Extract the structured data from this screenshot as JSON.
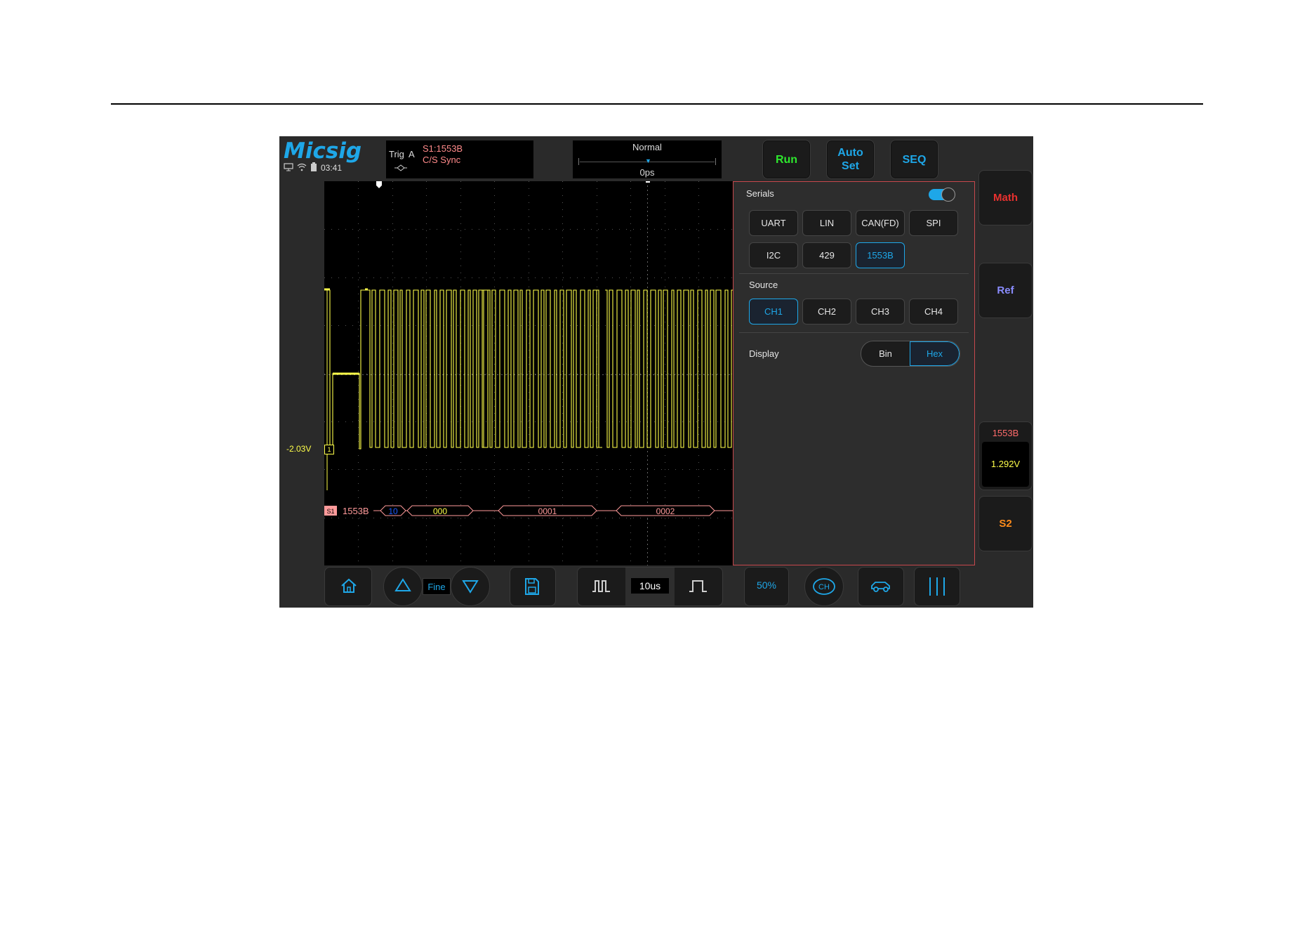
{
  "brand": {
    "logo": "Micsig"
  },
  "status": {
    "time": "03:41"
  },
  "trigger": {
    "label": "Trig",
    "channel": "A",
    "source": "S1:1553B",
    "mode": "C/S Sync"
  },
  "acquisition": {
    "mode": "Normal",
    "offset": "0ps"
  },
  "buttons": {
    "run": "Run",
    "autoset_line1": "Auto",
    "autoset_line2": "Set",
    "seq": "SEQ"
  },
  "side": {
    "math": "Math",
    "ref": "Ref",
    "decode_label": "1553B",
    "decode_value": "1.292V",
    "s2": "S2"
  },
  "channel": {
    "level": "-2.03V",
    "marker": "1"
  },
  "decode": {
    "badge": "S1",
    "protocol": "1553B",
    "frames": [
      {
        "label": "10",
        "color": "#1e5cff"
      },
      {
        "label": "000",
        "color": "#ffff4a"
      },
      {
        "label": "0001",
        "color": "#ff9a9a"
      },
      {
        "label": "0002",
        "color": "#ff9a9a"
      }
    ]
  },
  "panel": {
    "serials_title": "Serials",
    "serials_enabled": true,
    "protocols": [
      "UART",
      "LIN",
      "CAN(FD)",
      "SPI",
      "I2C",
      "429",
      "1553B"
    ],
    "selected_protocol": "1553B",
    "source_title": "Source",
    "sources": [
      "CH1",
      "CH2",
      "CH3",
      "CH4"
    ],
    "selected_source": "CH1",
    "display_title": "Display",
    "display_options": [
      "Bin",
      "Hex"
    ],
    "selected_display": "Hex"
  },
  "bottom": {
    "fine": "Fine",
    "timebase": "10us",
    "fifty": "50%"
  },
  "colors": {
    "accent": "#1ea7e8",
    "trace": "#ffff4a",
    "decode": "#ff9a9a",
    "run": "#2ee82e",
    "math": "#e8312f",
    "ref": "#8a8cff",
    "s2": "#ff8c1a",
    "panel_border": "#c7484c"
  }
}
